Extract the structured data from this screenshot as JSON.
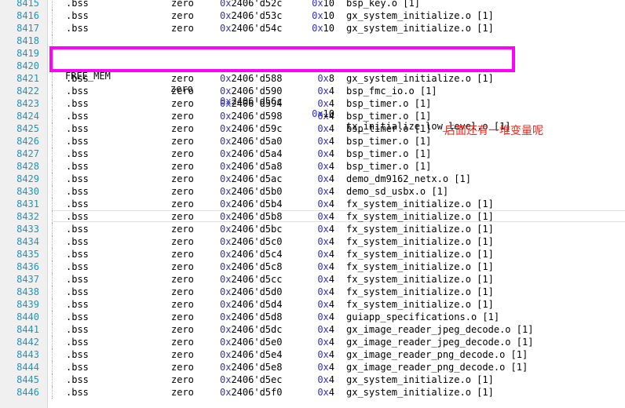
{
  "editor": {
    "rows": [
      {
        "ln": "8415",
        "section": ".bss",
        "type": "zero",
        "addr_prefix": "0x",
        "addr": "2406'd52c",
        "size_prefix": "0x",
        "size": "10",
        "obj": "bsp_key.o [1]"
      },
      {
        "ln": "8416",
        "section": ".bss",
        "type": "zero",
        "addr_prefix": "0x",
        "addr": "2406'd53c",
        "size_prefix": "0x",
        "size": "10",
        "obj": "gx_system_initialize.o [1]"
      },
      {
        "ln": "8417",
        "section": ".bss",
        "type": "zero",
        "addr_prefix": "0x",
        "addr": "2406'd54c",
        "size_prefix": "0x",
        "size": "10",
        "obj": "gx_system_initialize.o [1]"
      },
      {
        "ln": "8418",
        "section": "",
        "type": "",
        "addr_prefix": "",
        "addr": "",
        "size_prefix": "",
        "size": "",
        "obj": ""
      },
      {
        "ln": "8419",
        "section": "",
        "type": "",
        "addr_prefix": "",
        "addr": "",
        "size_prefix": "",
        "size": "",
        "obj": ""
      },
      {
        "ln": "8420",
        "section": "",
        "type": "",
        "addr_prefix": "",
        "addr": "",
        "size_prefix": "",
        "size": "",
        "obj": ""
      },
      {
        "ln": "8421",
        "section": ".bss",
        "type": "zero",
        "addr_prefix": "0x",
        "addr": "2406'd588",
        "size_prefix": "0x",
        "size": "8",
        "obj": "gx_system_initialize.o [1]"
      },
      {
        "ln": "8422",
        "section": ".bss",
        "type": "zero",
        "addr_prefix": "0x",
        "addr": "2406'd590",
        "size_prefix": "0x",
        "size": "4",
        "obj": "bsp_fmc_io.o [1]"
      },
      {
        "ln": "8423",
        "section": ".bss",
        "type": "zero",
        "addr_prefix": "0x",
        "addr": "2406'd594",
        "size_prefix": "0x",
        "size": "4",
        "obj": "bsp_timer.o [1]"
      },
      {
        "ln": "8424",
        "section": ".bss",
        "type": "zero",
        "addr_prefix": "0x",
        "addr": "2406'd598",
        "size_prefix": "0x",
        "size": "4",
        "obj": "bsp_timer.o [1]"
      },
      {
        "ln": "8425",
        "section": ".bss",
        "type": "zero",
        "addr_prefix": "0x",
        "addr": "2406'd59c",
        "size_prefix": "0x",
        "size": "4",
        "obj": "bsp_timer.o [1]"
      },
      {
        "ln": "8426",
        "section": ".bss",
        "type": "zero",
        "addr_prefix": "0x",
        "addr": "2406'd5a0",
        "size_prefix": "0x",
        "size": "4",
        "obj": "bsp_timer.o [1]"
      },
      {
        "ln": "8427",
        "section": ".bss",
        "type": "zero",
        "addr_prefix": "0x",
        "addr": "2406'd5a4",
        "size_prefix": "0x",
        "size": "4",
        "obj": "bsp_timer.o [1]"
      },
      {
        "ln": "8428",
        "section": ".bss",
        "type": "zero",
        "addr_prefix": "0x",
        "addr": "2406'd5a8",
        "size_prefix": "0x",
        "size": "4",
        "obj": "bsp_timer.o [1]"
      },
      {
        "ln": "8429",
        "section": ".bss",
        "type": "zero",
        "addr_prefix": "0x",
        "addr": "2406'd5ac",
        "size_prefix": "0x",
        "size": "4",
        "obj": "demo_dm9162_netx.o [1]"
      },
      {
        "ln": "8430",
        "section": ".bss",
        "type": "zero",
        "addr_prefix": "0x",
        "addr": "2406'd5b0",
        "size_prefix": "0x",
        "size": "4",
        "obj": "demo_sd_usbx.o [1]"
      },
      {
        "ln": "8431",
        "section": ".bss",
        "type": "zero",
        "addr_prefix": "0x",
        "addr": "2406'd5b4",
        "size_prefix": "0x",
        "size": "4",
        "obj": "fx_system_initialize.o [1]"
      },
      {
        "ln": "8432",
        "section": ".bss",
        "type": "zero",
        "addr_prefix": "0x",
        "addr": "2406'd5b8",
        "size_prefix": "0x",
        "size": "4",
        "obj": "fx_system_initialize.o [1]"
      },
      {
        "ln": "8433",
        "section": ".bss",
        "type": "zero",
        "addr_prefix": "0x",
        "addr": "2406'd5bc",
        "size_prefix": "0x",
        "size": "4",
        "obj": "fx_system_initialize.o [1]"
      },
      {
        "ln": "8434",
        "section": ".bss",
        "type": "zero",
        "addr_prefix": "0x",
        "addr": "2406'd5c0",
        "size_prefix": "0x",
        "size": "4",
        "obj": "fx_system_initialize.o [1]"
      },
      {
        "ln": "8435",
        "section": ".bss",
        "type": "zero",
        "addr_prefix": "0x",
        "addr": "2406'd5c4",
        "size_prefix": "0x",
        "size": "4",
        "obj": "fx_system_initialize.o [1]"
      },
      {
        "ln": "8436",
        "section": ".bss",
        "type": "zero",
        "addr_prefix": "0x",
        "addr": "2406'd5c8",
        "size_prefix": "0x",
        "size": "4",
        "obj": "fx_system_initialize.o [1]"
      },
      {
        "ln": "8437",
        "section": ".bss",
        "type": "zero",
        "addr_prefix": "0x",
        "addr": "2406'd5cc",
        "size_prefix": "0x",
        "size": "4",
        "obj": "fx_system_initialize.o [1]"
      },
      {
        "ln": "8438",
        "section": ".bss",
        "type": "zero",
        "addr_prefix": "0x",
        "addr": "2406'd5d0",
        "size_prefix": "0x",
        "size": "4",
        "obj": "fx_system_initialize.o [1]"
      },
      {
        "ln": "8439",
        "section": ".bss",
        "type": "zero",
        "addr_prefix": "0x",
        "addr": "2406'd5d4",
        "size_prefix": "0x",
        "size": "4",
        "obj": "fx_system_initialize.o [1]"
      },
      {
        "ln": "8440",
        "section": ".bss",
        "type": "zero",
        "addr_prefix": "0x",
        "addr": "2406'd5d8",
        "size_prefix": "0x",
        "size": "4",
        "obj": "guiapp_specifications.o [1]"
      },
      {
        "ln": "8441",
        "section": ".bss",
        "type": "zero",
        "addr_prefix": "0x",
        "addr": "2406'd5dc",
        "size_prefix": "0x",
        "size": "4",
        "obj": "gx_image_reader_jpeg_decode.o [1]"
      },
      {
        "ln": "8442",
        "section": ".bss",
        "type": "zero",
        "addr_prefix": "0x",
        "addr": "2406'd5e0",
        "size_prefix": "0x",
        "size": "4",
        "obj": "gx_image_reader_jpeg_decode.o [1]"
      },
      {
        "ln": "8443",
        "section": ".bss",
        "type": "zero",
        "addr_prefix": "0x",
        "addr": "2406'd5e4",
        "size_prefix": "0x",
        "size": "4",
        "obj": "gx_image_reader_png_decode.o [1]"
      },
      {
        "ln": "8444",
        "section": ".bss",
        "type": "zero",
        "addr_prefix": "0x",
        "addr": "2406'd5e8",
        "size_prefix": "0x",
        "size": "4",
        "obj": "gx_image_reader_png_decode.o [1]"
      },
      {
        "ln": "8445",
        "section": ".bss",
        "type": "zero",
        "addr_prefix": "0x",
        "addr": "2406'd5ec",
        "size_prefix": "0x",
        "size": "4",
        "obj": "gx_system_initialize.o [1]"
      },
      {
        "ln": "8446",
        "section": ".bss",
        "type": "zero",
        "addr_prefix": "0x",
        "addr": "2406'd5f0",
        "size_prefix": "0x",
        "size": "4",
        "obj": "gx_system_initialize.o [1]"
      }
    ]
  },
  "highlight": {
    "section": "FREE_MEM",
    "type": "zero",
    "addr_prefix": "0x",
    "addr": "2406'd56c",
    "size_prefix": "0x",
    "size": "10",
    "obj": "tx_initialize_low_level.o [1]",
    "border_color": "#ff00ff"
  },
  "annotation": {
    "text": "后面还有一堆变量呢",
    "color": "#e8281e"
  },
  "colors": {
    "line_number": "#2b91af",
    "hex_prefix": "#3030c8",
    "gutter_bg": "#f0f0f0"
  }
}
